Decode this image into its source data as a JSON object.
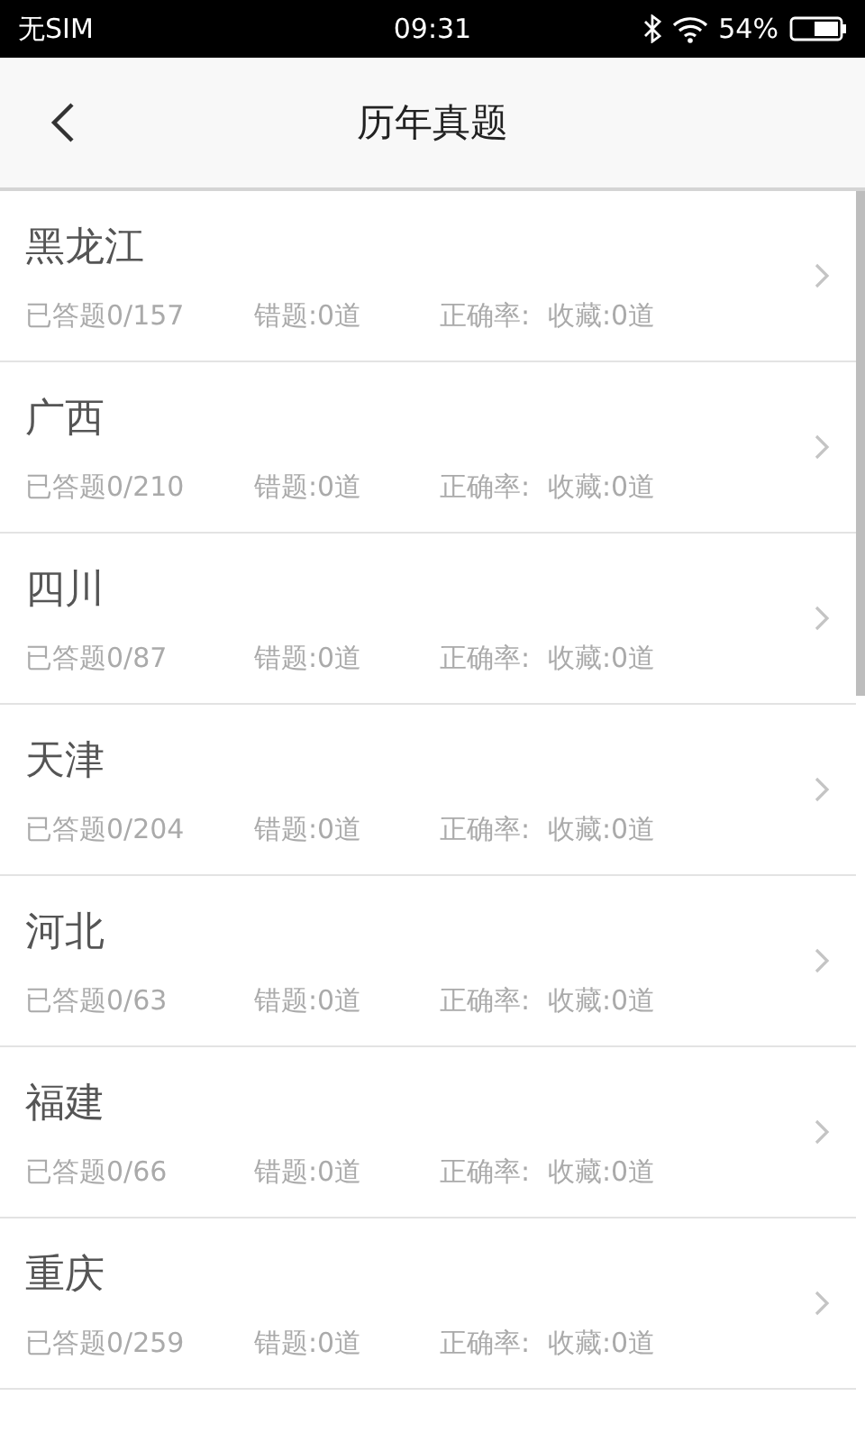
{
  "status_bar": {
    "carrier": "无SIM",
    "time": "09:31",
    "battery": "54%"
  },
  "header": {
    "title": "历年真题"
  },
  "rows": [
    {
      "name": "黑龙江",
      "answered": "已答题0/157",
      "wrong": "错题:0道",
      "accuracy": "正确率:",
      "favorites": "收藏:0道"
    },
    {
      "name": "广西",
      "answered": "已答题0/210",
      "wrong": "错题:0道",
      "accuracy": "正确率:",
      "favorites": "收藏:0道"
    },
    {
      "name": "四川",
      "answered": "已答题0/87",
      "wrong": "错题:0道",
      "accuracy": "正确率:",
      "favorites": "收藏:0道"
    },
    {
      "name": "天津",
      "answered": "已答题0/204",
      "wrong": "错题:0道",
      "accuracy": "正确率:",
      "favorites": "收藏:0道"
    },
    {
      "name": "河北",
      "answered": "已答题0/63",
      "wrong": "错题:0道",
      "accuracy": "正确率:",
      "favorites": "收藏:0道"
    },
    {
      "name": "福建",
      "answered": "已答题0/66",
      "wrong": "错题:0道",
      "accuracy": "正确率:",
      "favorites": "收藏:0道"
    },
    {
      "name": "重庆",
      "answered": "已答题0/259",
      "wrong": "错题:0道",
      "accuracy": "正确率:",
      "favorites": "收藏:0道"
    }
  ]
}
